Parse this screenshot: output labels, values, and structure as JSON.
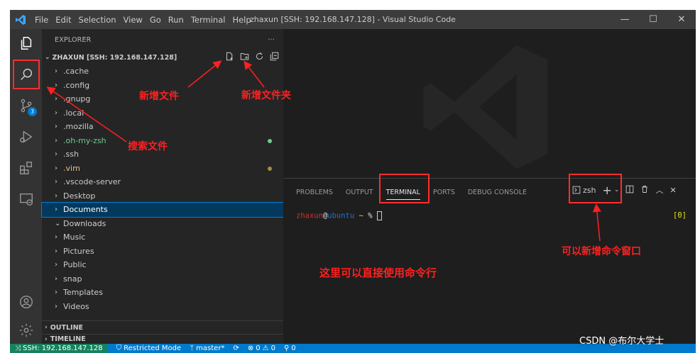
{
  "title_bar": {
    "menu": [
      "File",
      "Edit",
      "Selection",
      "View",
      "Go",
      "Run",
      "Terminal",
      "Help"
    ],
    "window_title": "zhaxun [SSH: 192.168.147.128] - Visual Studio Code",
    "controls": {
      "minimize": "—",
      "maximize": "☐",
      "close": "✕"
    }
  },
  "activity_bar": {
    "source_control_badge": "3"
  },
  "sidebar": {
    "header": "EXPLORER",
    "more": "···",
    "root": "ZHAXUN [SSH: 192.168.147.128]",
    "items": [
      {
        "label": ".cache",
        "color": "#cccccc",
        "chev": "›"
      },
      {
        "label": ".config",
        "color": "#cccccc",
        "chev": "›"
      },
      {
        "label": ".gnupg",
        "color": "#cccccc",
        "chev": "›"
      },
      {
        "label": ".local",
        "color": "#cccccc",
        "chev": "›"
      },
      {
        "label": ".mozilla",
        "color": "#cccccc",
        "chev": "›"
      },
      {
        "label": ".oh-my-zsh",
        "color": "#73c991",
        "chev": "›",
        "dot": "#73c991"
      },
      {
        "label": ".ssh",
        "color": "#cccccc",
        "chev": "›"
      },
      {
        "label": ".vim",
        "color": "#e2c08d",
        "chev": "›",
        "dot": "#a68a4a"
      },
      {
        "label": ".vscode-server",
        "color": "#cccccc",
        "chev": "›"
      },
      {
        "label": "Desktop",
        "color": "#cccccc",
        "chev": "›"
      },
      {
        "label": "Documents",
        "color": "#ffffff",
        "chev": "›",
        "selected": true
      },
      {
        "label": "Downloads",
        "color": "#cccccc",
        "chev": "⌄"
      },
      {
        "label": "Music",
        "color": "#cccccc",
        "chev": "›"
      },
      {
        "label": "Pictures",
        "color": "#cccccc",
        "chev": "›"
      },
      {
        "label": "Public",
        "color": "#cccccc",
        "chev": "›"
      },
      {
        "label": "snap",
        "color": "#cccccc",
        "chev": "›"
      },
      {
        "label": "Templates",
        "color": "#cccccc",
        "chev": "›"
      },
      {
        "label": "Videos",
        "color": "#cccccc",
        "chev": "›"
      }
    ],
    "outline": "OUTLINE",
    "timeline": "TIMELINE"
  },
  "panel": {
    "tabs": [
      "PROBLEMS",
      "OUTPUT",
      "TERMINAL",
      "PORTS",
      "DEBUG CONSOLE"
    ],
    "active_tab": "TERMINAL",
    "shell": "zsh",
    "prompt_user": "zhaxun",
    "prompt_at": "@",
    "prompt_host": "ubuntu",
    "prompt_dir": "~",
    "prompt_char": "%",
    "exit_code": "[0]"
  },
  "status_bar": {
    "remote": "SSH: 192.168.147.128",
    "restricted": "Restricted Mode",
    "branch": "master*",
    "errors": "0",
    "warnings": "0",
    "ports": "0"
  },
  "annotations": {
    "new_file": "新增文件",
    "new_folder": "新增文件夹",
    "search_files": "搜索文件",
    "new_terminal": "可以新增命令窗口",
    "terminal_note": "这里可以直接使用命令行"
  },
  "watermark": "CSDN @布尔大学士",
  "colors": {
    "accent": "#007acc",
    "remote_status": "#16825d",
    "annotation_red": "#ff2020"
  }
}
